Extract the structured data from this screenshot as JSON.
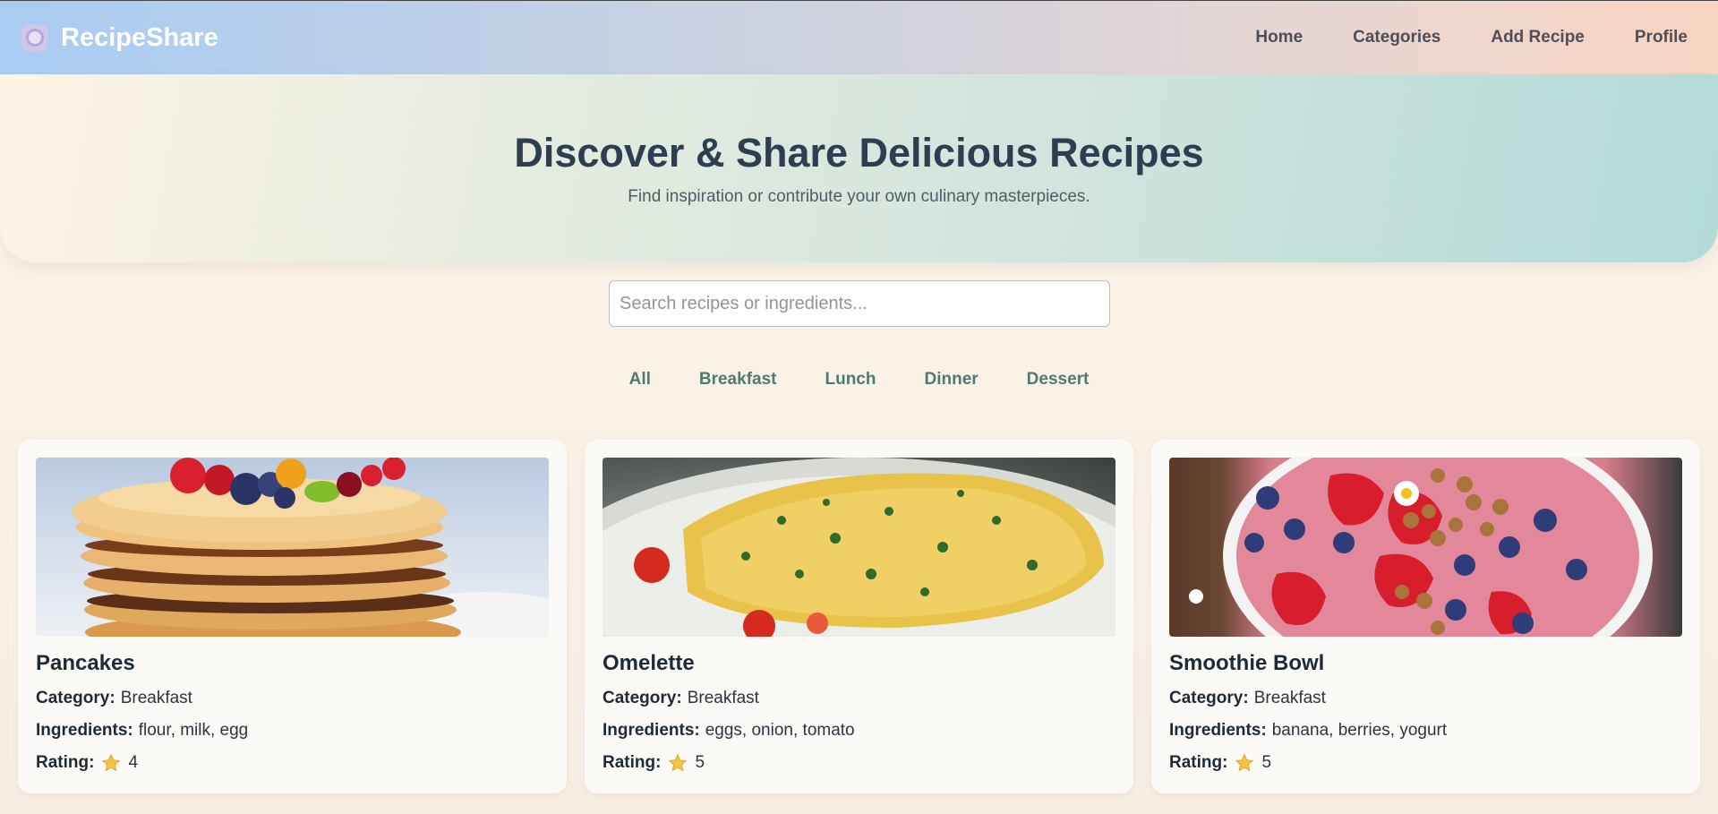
{
  "header": {
    "brand": "RecipeShare",
    "nav": [
      "Home",
      "Categories",
      "Add Recipe",
      "Profile"
    ]
  },
  "hero": {
    "title": "Discover & Share Delicious Recipes",
    "subtitle": "Find inspiration or contribute your own culinary masterpieces."
  },
  "search": {
    "placeholder": "Search recipes or ingredients..."
  },
  "filters": [
    "All",
    "Breakfast",
    "Lunch",
    "Dinner",
    "Dessert"
  ],
  "labels": {
    "category": "Category:",
    "ingredients": "Ingredients:",
    "rating": "Rating:"
  },
  "recipes": [
    {
      "name": "Pancakes",
      "category": "Breakfast",
      "ingredients": "flour, milk, egg",
      "rating": "4"
    },
    {
      "name": "Omelette",
      "category": "Breakfast",
      "ingredients": "eggs, onion, tomato",
      "rating": "5"
    },
    {
      "name": "Smoothie Bowl",
      "category": "Breakfast",
      "ingredients": "banana, berries, yogurt",
      "rating": "5"
    }
  ],
  "colors": {
    "header_gradient_start": "#a9ccf3",
    "header_gradient_end": "#f8d5c2",
    "filter_text": "#4d7a72",
    "star": "#f5c542"
  }
}
